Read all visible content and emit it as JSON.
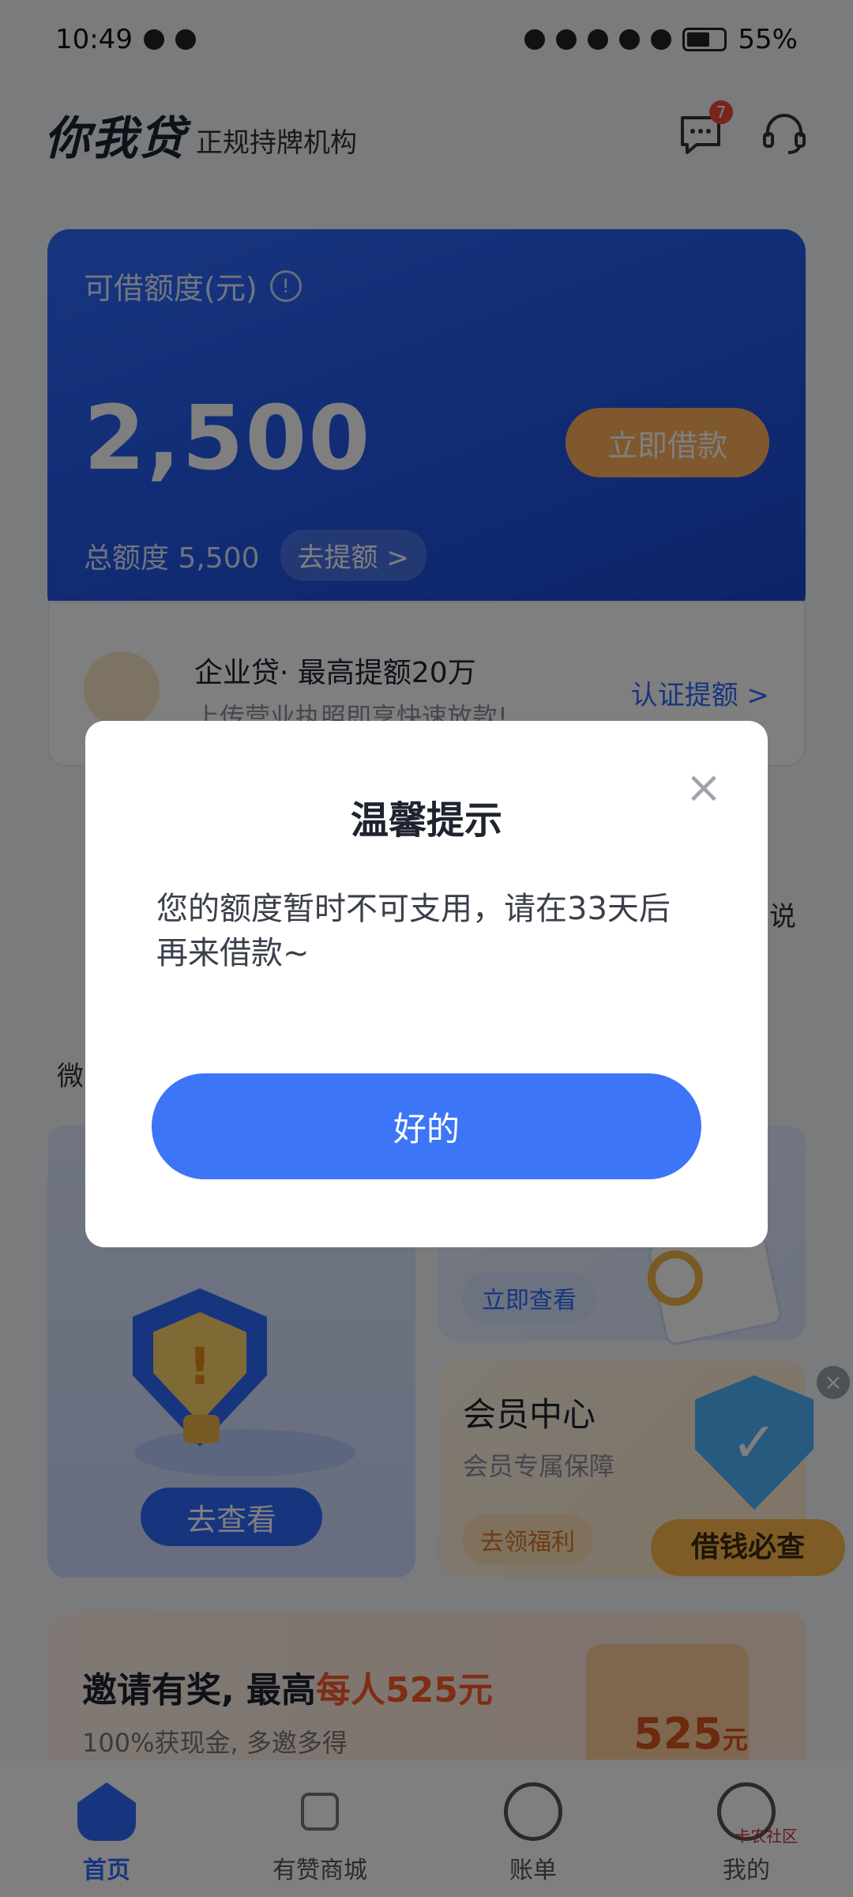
{
  "status_bar": {
    "time": "10:49",
    "battery": "55%"
  },
  "header": {
    "brand": "你我贷",
    "slogan": "正规持牌机构",
    "message_count": "7",
    "icons": [
      "message-icon",
      "customer-service-icon"
    ]
  },
  "credit_card": {
    "title": "可借额度(元)",
    "amount": "2,500",
    "borrow_button": "立即借款",
    "total_label": "总额度 5,500",
    "raise_button": "去提额 >"
  },
  "business_loan": {
    "title": "企业贷· 最高提额20万",
    "subtitle": "上传营业执照即享快速放款!",
    "link": "认证提额 >"
  },
  "background_text": {
    "right_fragment": "说",
    "left_fragment": "微"
  },
  "tiles": {
    "left_button": "去查看",
    "right_top_button": "立即查看",
    "vip_title": "会员中心",
    "vip_subtitle": "会员专属保障",
    "vip_button": "去领福利",
    "ad_text": "借钱必查"
  },
  "invite": {
    "title_prefix": "邀请有奖, 最高",
    "title_highlight": "每人525元",
    "subtitle": "100%获现金, 多邀多得",
    "envelope_value": "525",
    "envelope_unit": "元"
  },
  "tabbar": [
    {
      "label": "首页"
    },
    {
      "label": "有赞商城"
    },
    {
      "label": "账单"
    },
    {
      "label": "我的"
    }
  ],
  "watermark": "卡农社区",
  "dialog": {
    "title": "温馨提示",
    "body": "您的额度暂时不可支用，请在33天后再来借款~",
    "ok_button": "好的"
  },
  "colors": {
    "primary": "#3d75f7",
    "card_blue": "#2155e6",
    "accent_orange": "#ffb15c"
  }
}
